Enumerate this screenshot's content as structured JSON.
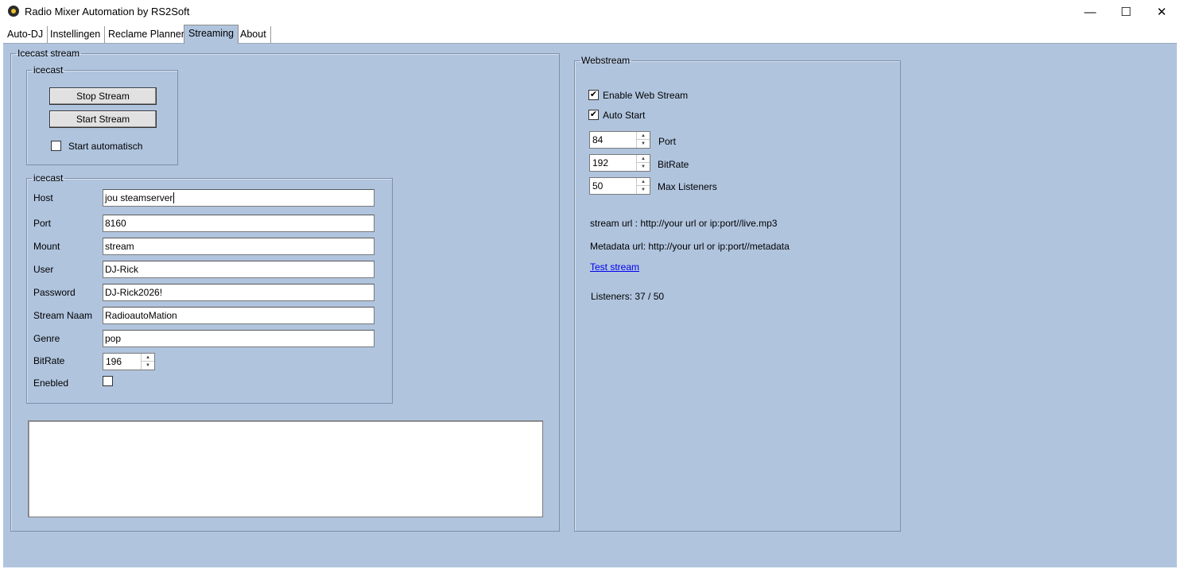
{
  "window": {
    "title": "Radio Mixer Automation by RS2Soft",
    "minimize_glyph": "—",
    "maximize_glyph": "☐",
    "close_glyph": "✕"
  },
  "tabs": [
    {
      "label": "Auto-DJ"
    },
    {
      "label": "Instellingen"
    },
    {
      "label": "Reclame Planner"
    },
    {
      "label": "Streaming",
      "active": true
    },
    {
      "label": "About"
    }
  ],
  "icecast_stream": {
    "legend": "Icecast stream",
    "control": {
      "legend": "icecast",
      "stop_label": "Stop Stream",
      "start_label": "Start Stream",
      "auto_label": "Start automatisch",
      "auto_checked": false
    },
    "settings": {
      "legend": "icecast",
      "host_label": "Host",
      "host_value": "jou steamserver",
      "port_label": "Port",
      "port_value": "8160",
      "mount_label": "Mount",
      "mount_value": "stream",
      "user_label": "User",
      "user_value": "DJ-Rick",
      "password_label": "Password",
      "password_value": "DJ-Rick2026!",
      "name_label": "Stream Naam",
      "name_value": "RadioautoMation",
      "genre_label": "Genre",
      "genre_value": "pop",
      "bitrate_label": "BitRate",
      "bitrate_value": "196",
      "enabled_label": "Enebled",
      "enabled_checked": false
    },
    "log_text": ""
  },
  "webstream": {
    "legend": "Webstream",
    "enable_label": "Enable Web Stream",
    "enable_checked": true,
    "autostart_label": "Auto Start",
    "autostart_checked": true,
    "port_value": "84",
    "port_label": "Port",
    "bitrate_value": "192",
    "bitrate_label": "BitRate",
    "maxlisteners_value": "50",
    "maxlisteners_label": "Max Listeners",
    "stream_url": "stream url : http://your url or ip:port//live.mp3",
    "metadata_url": "Metadata url: http://your url or ip:port//metadata",
    "test_link": "Test stream",
    "listeners": "Listeners: 37 / 50"
  },
  "colors": {
    "panel_bg": "#b0c4de",
    "link": "#0000ee"
  }
}
